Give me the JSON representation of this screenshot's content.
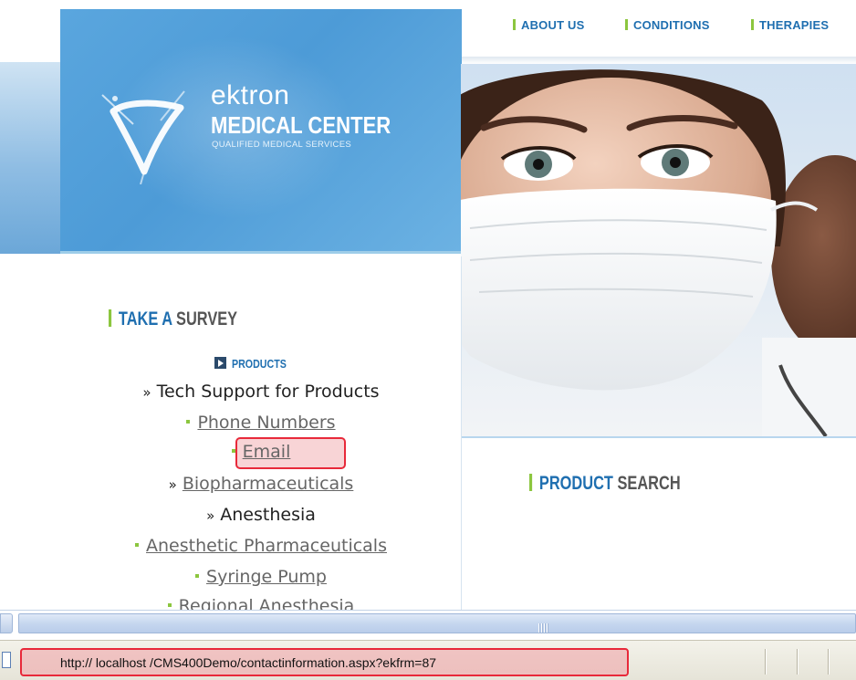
{
  "nav": {
    "items": [
      "ABOUT US",
      "CONDITIONS",
      "THERAPIES"
    ]
  },
  "logo": {
    "brand": "ektron",
    "title": "MEDICAL CENTER",
    "tagline": "QUALIFIED MEDICAL SERVICES"
  },
  "survey": {
    "head_a": "TAKE A",
    "head_b": "SURVEY"
  },
  "products": {
    "label": "PRODUCTS",
    "tree": [
      {
        "text": "Tech Support for Products",
        "kind": "folder",
        "link": false
      },
      {
        "text": "Phone Numbers",
        "kind": "item",
        "link": true
      },
      {
        "text": "Email",
        "kind": "item",
        "link": true,
        "highlighted": true
      },
      {
        "text": "Biopharmaceuticals",
        "kind": "folder",
        "link": true
      },
      {
        "text": "Anesthesia",
        "kind": "folder",
        "link": false
      },
      {
        "text": "Anesthetic Pharmaceuticals",
        "kind": "item",
        "link": true
      },
      {
        "text": "Syringe Pump",
        "kind": "item",
        "link": true
      },
      {
        "text": "Regional Anesthesia",
        "kind": "item",
        "link": true
      }
    ]
  },
  "product_search": {
    "head_a": "PRODUCT",
    "head_b": "SEARCH"
  },
  "status": {
    "url": "http:// localhost /CMS400Demo/contactinformation.aspx?ekfrm=87"
  },
  "colors": {
    "brand_blue": "#1f6fb0",
    "accent_green": "#8cc63f",
    "highlight_red": "#e8293a"
  }
}
